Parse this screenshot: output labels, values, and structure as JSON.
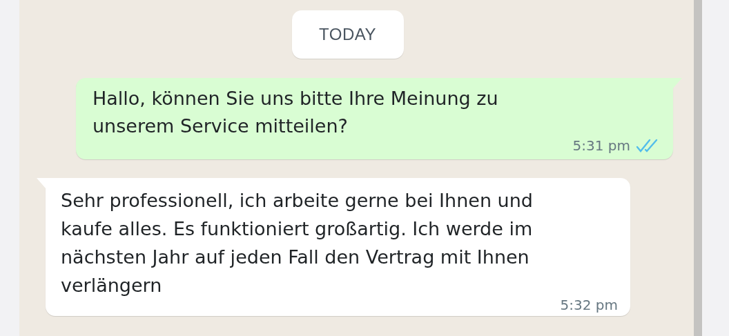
{
  "date_chip": "TODAY",
  "messages": [
    {
      "kind": "outgoing",
      "text": "Hallo, können Sie uns bitte Ihre Meinung zu unserem Service mitteilen?",
      "time": "5:31 pm",
      "read": true
    },
    {
      "kind": "incoming",
      "text": "Sehr professionell, ich arbeite gerne bei Ihnen und kaufe alles. Es funktioniert großartig. Ich werde im nächsten Jahr auf jeden Fall den Vertrag mit Ihnen verlängern",
      "time": "5:32 pm"
    }
  ]
}
